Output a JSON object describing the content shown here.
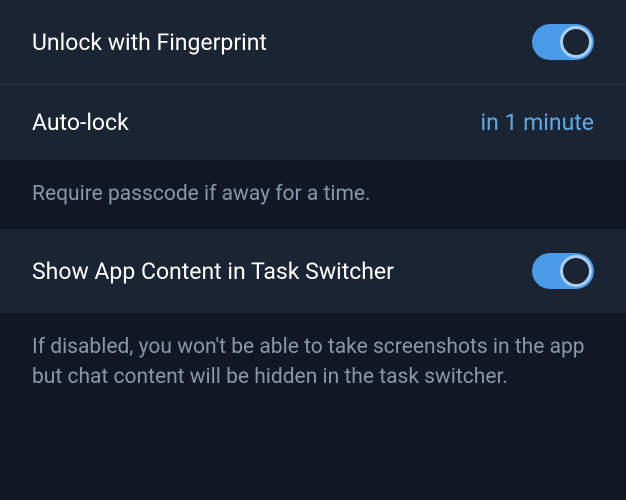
{
  "settings": {
    "fingerprint": {
      "label": "Unlock with Fingerprint",
      "enabled": true
    },
    "autolock": {
      "label": "Auto-lock",
      "value": "in 1 minute",
      "help": "Require passcode if away for a time."
    },
    "task_switcher": {
      "label": "Show App Content in Task Switcher",
      "enabled": true,
      "help": "If disabled, you won't be able to take screenshots in the app but chat content will be hidden in the task switcher."
    }
  },
  "colors": {
    "accent": "#5fa8e8",
    "toggle_on": "#4a9be8",
    "bg_row": "#1a2433",
    "bg_page": "#0f1824",
    "text_primary": "#ffffff",
    "text_muted": "#8a97a8"
  }
}
